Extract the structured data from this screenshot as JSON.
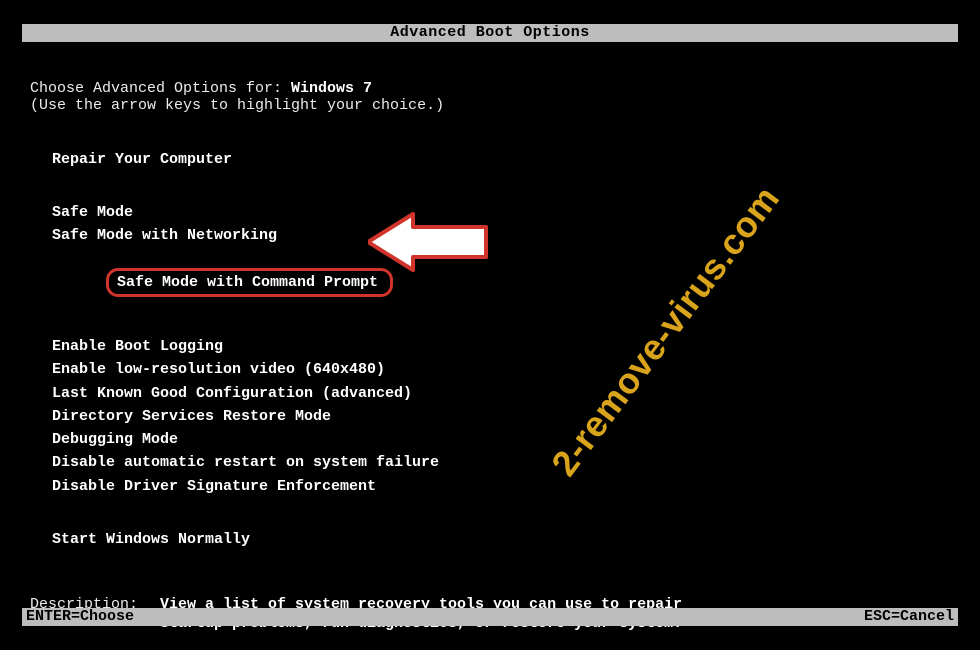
{
  "title": "Advanced Boot Options",
  "prompt_prefix": "Choose Advanced Options for: ",
  "os_name": "Windows 7",
  "hint": "(Use the arrow keys to highlight your choice.)",
  "group1": [
    "Repair Your Computer"
  ],
  "group2": [
    "Safe Mode",
    "Safe Mode with Networking",
    "Safe Mode with Command Prompt"
  ],
  "group2_highlight_index": 2,
  "group3": [
    "Enable Boot Logging",
    "Enable low-resolution video (640x480)",
    "Last Known Good Configuration (advanced)",
    "Directory Services Restore Mode",
    "Debugging Mode",
    "Disable automatic restart on system failure",
    "Disable Driver Signature Enforcement"
  ],
  "group4": [
    "Start Windows Normally"
  ],
  "description_label": "Description:",
  "description_body": "View a list of system recovery tools you can use to repair startup problems, run diagnostics, or restore your system.",
  "footer_left": "ENTER=Choose",
  "footer_right": "ESC=Cancel",
  "watermark": "2-remove-virus.com"
}
